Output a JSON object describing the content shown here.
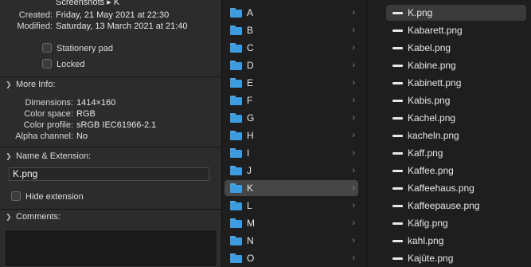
{
  "info_panel": {
    "header_partial": "Screenshots ▸ K",
    "created": {
      "label": "Created:",
      "value": "Friday, 21 May 2021 at 22:30"
    },
    "modified": {
      "label": "Modified:",
      "value": "Saturday, 13 March 2021 at 21:40"
    },
    "stationery_pad": "Stationery pad",
    "locked": "Locked",
    "more_info": {
      "title": "More Info:",
      "dimensions": {
        "label": "Dimensions:",
        "value": "1414×160"
      },
      "color_space": {
        "label": "Color space:",
        "value": "RGB"
      },
      "color_profile": {
        "label": "Color profile:",
        "value": "sRGB IEC61966-2.1"
      },
      "alpha_channel": {
        "label": "Alpha channel:",
        "value": "No"
      }
    },
    "name_extension": {
      "title": "Name & Extension:",
      "filename": "K.png",
      "hide_extension": "Hide extension"
    },
    "comments": {
      "title": "Comments:"
    }
  },
  "folders": [
    "A",
    "B",
    "C",
    "D",
    "E",
    "F",
    "G",
    "H",
    "I",
    "J",
    "K",
    "L",
    "M",
    "N",
    "O"
  ],
  "selected_folder": "K",
  "files": [
    "K.png",
    "Kabarett.png",
    "Kabel.png",
    "Kabine.png",
    "Kabinett.png",
    "Kabis.png",
    "Kachel.png",
    "kacheln.png",
    "Kaff.png",
    "Kaffee.png",
    "Kaffeehaus.png",
    "Kaffeepause.png",
    "Käfig.png",
    "kahl.png",
    "Kajüte.png"
  ],
  "selected_file": "K.png",
  "icons": {
    "folder": "folder-icon",
    "file": "image-file-icon",
    "chevron": "chevron-right-icon",
    "disclosure": "disclosure-down-icon"
  }
}
